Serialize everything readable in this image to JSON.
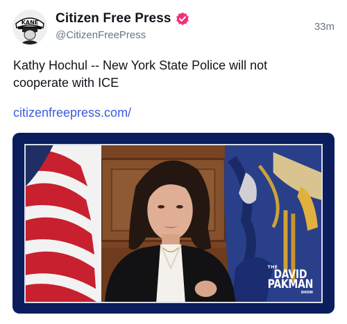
{
  "post": {
    "author_name": "Citizen Free Press",
    "author_handle": "@CitizenFreePress",
    "timestamp": "33m",
    "avatar_text": "KANE",
    "text": "Kathy Hochul -- New York State Police will not cooperate with ICE",
    "link_text": "citizenfreepress.com/",
    "verified_badge_color": "#f2317a"
  },
  "media": {
    "frame_color": "#0b1d5c",
    "watermark": {
      "the": "THE",
      "line1": "DAVID",
      "line2": "PAKMAN",
      "show": "SHOW"
    }
  }
}
